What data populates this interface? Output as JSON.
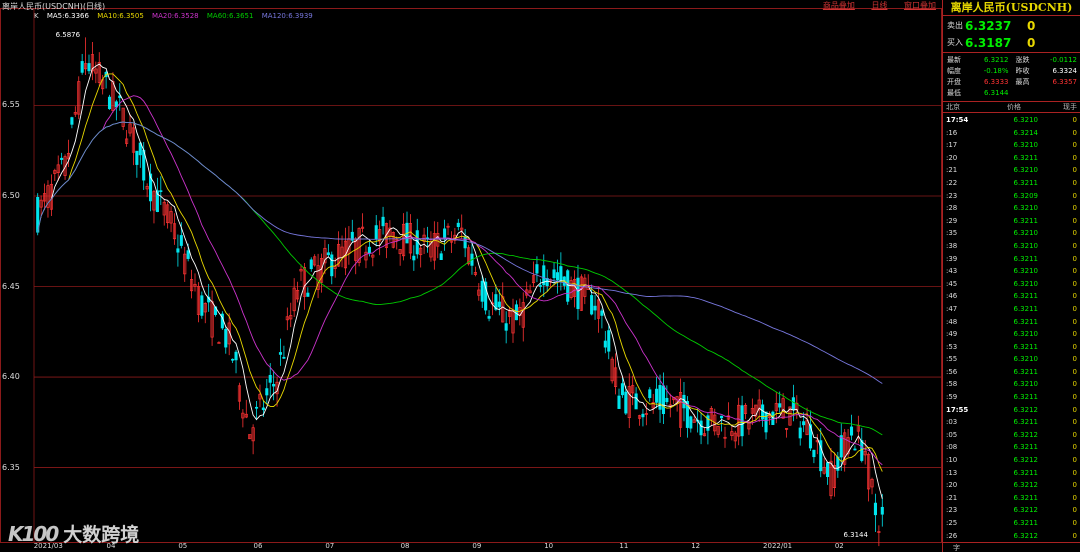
{
  "window": {
    "title": "离岸人民币(USDCNH)(日线)",
    "top_links": [
      "商品叠加",
      "日线",
      "窗口叠加"
    ]
  },
  "ma_legend": {
    "k": "K",
    "ma5": "MA5:6.3366",
    "ma10": "MA10:6.3505",
    "ma20": "MA20:6.3528",
    "ma60": "MA60:6.3651",
    "ma120": "MA120:6.3939"
  },
  "colors": {
    "up": "#ff3333",
    "down": "#00e5ee",
    "ma5": "#ffffff",
    "ma10": "#e8d800",
    "ma20": "#cc33cc",
    "ma60": "#00cc00",
    "ma120": "#7777dd",
    "grid": "#8b1a1a"
  },
  "watermark": {
    "logo": "K100",
    "text": "大数跨境"
  },
  "chart_data": {
    "type": "candlestick",
    "ylim": [
      6.31,
      6.595
    ],
    "y_ticks": [
      "6.55",
      "6.50",
      "6.45",
      "6.40",
      "6.35"
    ],
    "y_tick_values": [
      6.55,
      6.5,
      6.45,
      6.4,
      6.35
    ],
    "x_labels": [
      "2021/03",
      "04",
      "05",
      "06",
      "07",
      "08",
      "09",
      "10",
      "11",
      "12",
      "2022/01",
      "02"
    ],
    "x_label_positions": [
      0,
      21,
      42,
      64,
      85,
      107,
      128,
      149,
      171,
      192,
      213,
      234
    ],
    "high_label": "6.5876",
    "low_label": "6.3144",
    "high_value": 6.5876,
    "low_value": 6.3144,
    "high_index": 14,
    "low_index": 245,
    "count": 248
  },
  "panel": {
    "name": "离岸人民币(USDCNH)",
    "sell_label": "卖出",
    "sell_price": "6.3237",
    "sell_vol": "0",
    "buy_label": "买入",
    "buy_price": "6.3187",
    "buy_vol": "0",
    "stats": [
      [
        {
          "l": "最新",
          "v": "6.3212",
          "c": "#00ee00"
        },
        {
          "l": "涨跌",
          "v": "-0.0112",
          "c": "#00ee00"
        }
      ],
      [
        {
          "l": "幅度",
          "v": "-0.18%",
          "c": "#00ee00"
        },
        {
          "l": "昨收",
          "v": "6.3324",
          "c": "#ffffff"
        }
      ],
      [
        {
          "l": "开盘",
          "v": "6.3333",
          "c": "#ff3333"
        },
        {
          "l": "最高",
          "v": "6.3357",
          "c": "#ff3333"
        }
      ],
      [
        {
          "l": "最低",
          "v": "6.3144",
          "c": "#00ee00"
        },
        {
          "l": "",
          "v": "",
          "c": "#ffffff"
        }
      ]
    ],
    "tick_headers": [
      "北京",
      "价格",
      "现手"
    ],
    "ticks": [
      {
        "t": "17:54",
        "p": "6.3210",
        "v": "0"
      },
      {
        "t": ":16",
        "p": "6.3214",
        "v": "0"
      },
      {
        "t": ":17",
        "p": "6.3210",
        "v": "0"
      },
      {
        "t": ":20",
        "p": "6.3211",
        "v": "0"
      },
      {
        "t": ":21",
        "p": "6.3210",
        "v": "0"
      },
      {
        "t": ":22",
        "p": "6.3211",
        "v": "0"
      },
      {
        "t": ":23",
        "p": "6.3209",
        "v": "0"
      },
      {
        "t": ":28",
        "p": "6.3210",
        "v": "0"
      },
      {
        "t": ":29",
        "p": "6.3211",
        "v": "0"
      },
      {
        "t": ":35",
        "p": "6.3210",
        "v": "0"
      },
      {
        "t": ":38",
        "p": "6.3210",
        "v": "0"
      },
      {
        "t": ":39",
        "p": "6.3211",
        "v": "0"
      },
      {
        "t": ":43",
        "p": "6.3210",
        "v": "0"
      },
      {
        "t": ":45",
        "p": "6.3210",
        "v": "0"
      },
      {
        "t": ":46",
        "p": "6.3211",
        "v": "0"
      },
      {
        "t": ":47",
        "p": "6.3211",
        "v": "0"
      },
      {
        "t": ":48",
        "p": "6.3211",
        "v": "0"
      },
      {
        "t": ":49",
        "p": "6.3210",
        "v": "0"
      },
      {
        "t": ":53",
        "p": "6.3211",
        "v": "0"
      },
      {
        "t": ":55",
        "p": "6.3210",
        "v": "0"
      },
      {
        "t": ":56",
        "p": "6.3211",
        "v": "0"
      },
      {
        "t": ":58",
        "p": "6.3210",
        "v": "0"
      },
      {
        "t": ":59",
        "p": "6.3211",
        "v": "0"
      },
      {
        "t": "17:55",
        "p": "6.3212",
        "v": "0"
      },
      {
        "t": ":03",
        "p": "6.3211",
        "v": "0"
      },
      {
        "t": ":05",
        "p": "6.3212",
        "v": "0"
      },
      {
        "t": ":08",
        "p": "6.3211",
        "v": "0"
      },
      {
        "t": ":10",
        "p": "6.3212",
        "v": "0"
      },
      {
        "t": ":13",
        "p": "6.3211",
        "v": "0"
      },
      {
        "t": ":20",
        "p": "6.3212",
        "v": "0"
      },
      {
        "t": ":21",
        "p": "6.3211",
        "v": "0"
      },
      {
        "t": ":23",
        "p": "6.3212",
        "v": "0"
      },
      {
        "t": ":25",
        "p": "6.3211",
        "v": "0"
      },
      {
        "t": ":26",
        "p": "6.3212",
        "v": "0"
      }
    ],
    "footer": "字"
  }
}
